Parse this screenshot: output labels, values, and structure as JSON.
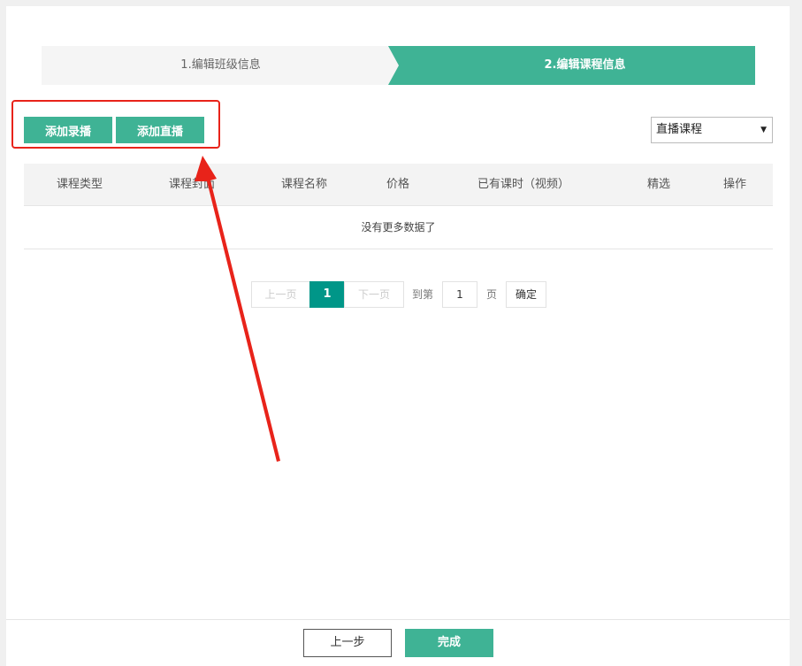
{
  "steps": {
    "step1": "1.编辑班级信息",
    "step2": "2.编辑课程信息"
  },
  "toolbar": {
    "add_record": "添加录播",
    "add_live": "添加直播",
    "course_select": "直播课程",
    "caret": "▼"
  },
  "table": {
    "headers": [
      "课程类型",
      "课程封面",
      "课程名称",
      "价格",
      "已有课时（视频）",
      "精选",
      "操作"
    ],
    "empty_text": "没有更多数据了"
  },
  "pagination": {
    "prev": "上一页",
    "current": "1",
    "next": "下一页",
    "goto_label": "到第",
    "page_input": "1",
    "page_unit": "页",
    "confirm": "确定"
  },
  "footer": {
    "prev_step": "上一步",
    "finish": "完成"
  },
  "colors": {
    "accent": "#3fb395",
    "annotation": "#e8231a"
  }
}
